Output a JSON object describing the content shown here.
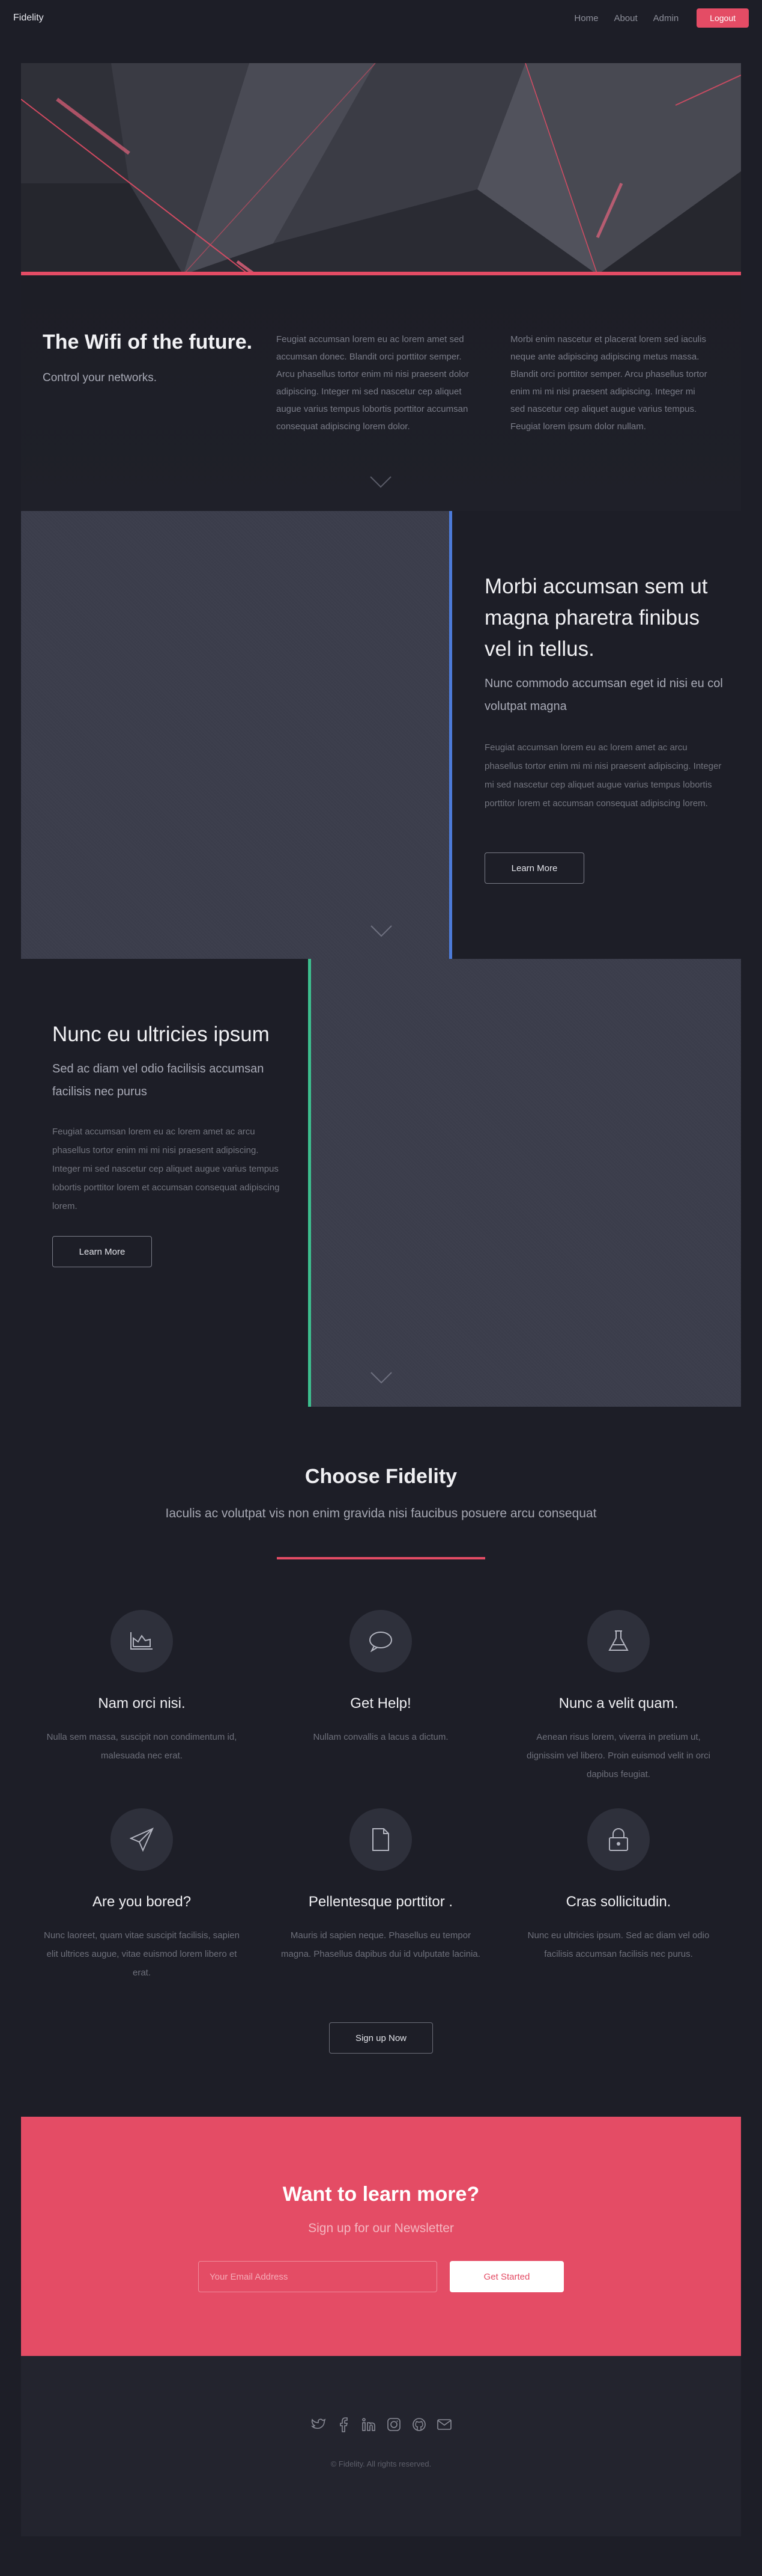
{
  "header": {
    "brand": "Fidelity",
    "nav": [
      "Home",
      "About",
      "Admin"
    ],
    "logout_label": "Logout"
  },
  "intro": {
    "title": "The Wifi of the future.",
    "subtitle": "Control your networks.",
    "col1": "Feugiat accumsan lorem eu ac lorem amet sed accumsan donec. Blandit orci porttitor semper. Arcu phasellus tortor enim mi nisi praesent dolor adipiscing. Integer mi sed nascetur cep aliquet augue varius tempus lobortis porttitor accumsan consequat adipiscing lorem dolor.",
    "col2": "Morbi enim nascetur et placerat lorem sed iaculis neque ante adipiscing adipiscing metus massa. Blandit orci porttitor semper. Arcu phasellus tortor enim mi mi nisi praesent adipiscing. Integer mi sed nascetur cep aliquet augue varius tempus. Feugiat lorem ipsum dolor nullam."
  },
  "panel1": {
    "title": "Morbi accumsan sem ut magna pharetra finibus vel in tellus.",
    "lead": "Nunc commodo accumsan eget id nisi eu col volutpat magna",
    "body": "Feugiat accumsan lorem eu ac lorem amet ac arcu phasellus tortor enim mi mi nisi praesent adipiscing. Integer mi sed nascetur cep aliquet augue varius tempus lobortis porttitor lorem et accumsan consequat adipiscing lorem.",
    "button": "Learn More",
    "accent_color": "#4c7bd9"
  },
  "panel2": {
    "title": "Nunc eu ultricies ipsum",
    "lead": "Sed ac diam vel odio facilisis accumsan facilisis nec purus",
    "body": "Feugiat accumsan lorem eu ac lorem amet ac arcu phasellus tortor enim mi mi nisi praesent adipiscing. Integer mi sed nascetur cep aliquet augue varius tempus lobortis porttitor lorem et accumsan consequat adipiscing lorem.",
    "button": "Learn More",
    "accent_color": "#3dbf8e"
  },
  "choose": {
    "title": "Choose Fidelity",
    "subtitle": "Iaculis ac volutpat vis non enim gravida nisi faucibus posuere arcu consequat",
    "features": [
      {
        "icon": "area-chart-icon",
        "title": "Nam orci nisi.",
        "text": "Nulla sem massa, suscipit non condimentum id, malesuada nec erat."
      },
      {
        "icon": "speech-bubble-icon",
        "title": "Get Help!",
        "text": "Nullam convallis a lacus a dictum."
      },
      {
        "icon": "flask-icon",
        "title": "Nunc a velit quam.",
        "text": "Aenean risus lorem, viverra in pretium ut, dignissim vel libero. Proin euismod velit in orci dapibus feugiat."
      },
      {
        "icon": "paper-plane-icon",
        "title": "Are you bored?",
        "text": "Nunc laoreet, quam vitae suscipit facilisis, sapien elit ultrices augue, vitae euismod lorem libero et erat."
      },
      {
        "icon": "document-icon",
        "title": "Pellentesque porttitor .",
        "text": "Mauris id sapien neque. Phasellus eu tempor magna. Phasellus dapibus dui id vulputate lacinia."
      },
      {
        "icon": "lock-icon",
        "title": "Cras sollicitudin.",
        "text": "Nunc eu ultricies ipsum. Sed ac diam vel odio facilisis accumsan facilisis nec purus."
      }
    ],
    "signup_label": "Sign up Now"
  },
  "newsletter": {
    "title": "Want to learn more?",
    "subtitle": "Sign up for our Newsletter",
    "email_placeholder": "Your Email Address",
    "button": "Get Started"
  },
  "footer": {
    "socials": [
      "twitter-icon",
      "facebook-icon",
      "linkedin-icon",
      "instagram-icon",
      "github-icon",
      "email-icon"
    ],
    "copyright": "© Fidelity. All rights reserved."
  },
  "colors": {
    "accent": "#e44c65",
    "background": "#1d1e27",
    "panel_image": "#3b3d4b"
  }
}
